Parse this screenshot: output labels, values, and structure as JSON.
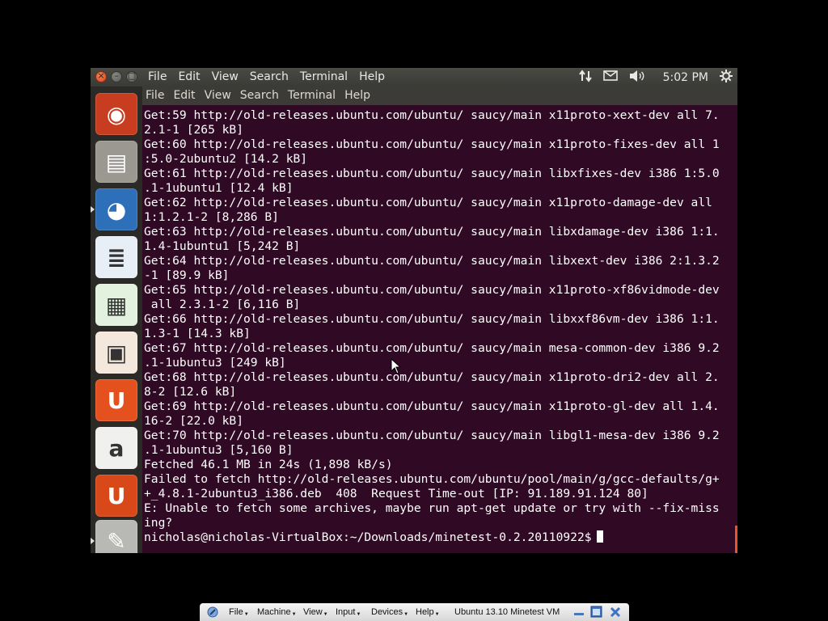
{
  "panel": {
    "menu": [
      "File",
      "Edit",
      "View",
      "Search",
      "Terminal",
      "Help"
    ],
    "clock": "5:02 PM",
    "indicators": {
      "network": "network-updown-icon",
      "mail": "envelope-icon",
      "sound": "speaker-icon",
      "session": "gear-icon"
    }
  },
  "terminal": {
    "menu": [
      "File",
      "Edit",
      "View",
      "Search",
      "Terminal",
      "Help"
    ],
    "lines": [
      "Get:59 http://old-releases.ubuntu.com/ubuntu/ saucy/main x11proto-xext-dev all 7.",
      "2.1-1 [265 kB]",
      "Get:60 http://old-releases.ubuntu.com/ubuntu/ saucy/main x11proto-fixes-dev all 1",
      ":5.0-2ubuntu2 [14.2 kB]",
      "Get:61 http://old-releases.ubuntu.com/ubuntu/ saucy/main libxfixes-dev i386 1:5.0",
      ".1-1ubuntu1 [12.4 kB]",
      "Get:62 http://old-releases.ubuntu.com/ubuntu/ saucy/main x11proto-damage-dev all",
      "1:1.2.1-2 [8,286 B]",
      "Get:63 http://old-releases.ubuntu.com/ubuntu/ saucy/main libxdamage-dev i386 1:1.",
      "1.4-1ubuntu1 [5,242 B]",
      "Get:64 http://old-releases.ubuntu.com/ubuntu/ saucy/main libxext-dev i386 2:1.3.2",
      "-1 [89.9 kB]",
      "Get:65 http://old-releases.ubuntu.com/ubuntu/ saucy/main x11proto-xf86vidmode-dev",
      " all 2.3.1-2 [6,116 B]",
      "Get:66 http://old-releases.ubuntu.com/ubuntu/ saucy/main libxxf86vm-dev i386 1:1.",
      "1.3-1 [14.3 kB]",
      "Get:67 http://old-releases.ubuntu.com/ubuntu/ saucy/main mesa-common-dev i386 9.2",
      ".1-1ubuntu3 [249 kB]",
      "Get:68 http://old-releases.ubuntu.com/ubuntu/ saucy/main x11proto-dri2-dev all 2.",
      "8-2 [12.6 kB]",
      "Get:69 http://old-releases.ubuntu.com/ubuntu/ saucy/main x11proto-gl-dev all 1.4.",
      "16-2 [22.0 kB]",
      "Get:70 http://old-releases.ubuntu.com/ubuntu/ saucy/main libgl1-mesa-dev i386 9.2",
      ".1-1ubuntu3 [5,160 B]",
      "Fetched 46.1 MB in 24s (1,898 kB/s)",
      "Failed to fetch http://old-releases.ubuntu.com/ubuntu/pool/main/g/gcc-defaults/g+",
      "+_4.8.1-2ubuntu3_i386.deb  408  Request Time-out [IP: 91.189.91.124 80]",
      "E: Unable to fetch some archives, maybe run apt-get update or try with --fix-miss",
      "ing?"
    ],
    "prompt": "nicholas@nicholas-VirtualBox:~/Downloads/minetest-0.2.20110922$ "
  },
  "launcher": {
    "items": [
      {
        "name": "ubuntu-dash-icon",
        "glyph": "◉",
        "color": "#c83d1f"
      },
      {
        "name": "files-cabinet-icon",
        "glyph": "▤",
        "color": "#9a9890"
      },
      {
        "name": "firefox-icon",
        "glyph": "◕",
        "color": "#2d6fb8"
      },
      {
        "name": "libreoffice-writer-icon",
        "glyph": "≣",
        "color": "#e8eef6"
      },
      {
        "name": "libreoffice-calc-icon",
        "glyph": "▦",
        "color": "#e3f2df"
      },
      {
        "name": "libreoffice-impress-icon",
        "glyph": "▣",
        "color": "#f4e8dc"
      },
      {
        "name": "ubuntu-software-center-icon",
        "glyph": "U",
        "color": "#e4501e"
      },
      {
        "name": "amazon-icon",
        "glyph": "a",
        "color": "#f0f0ee"
      },
      {
        "name": "ubuntu-one-icon",
        "glyph": "U",
        "color": "#d94819"
      },
      {
        "name": "system-settings-icon",
        "glyph": "✎",
        "color": "#b8b8b4"
      }
    ]
  },
  "vbox": {
    "menu": [
      "File",
      "Machine",
      "View",
      "Input",
      "Devices",
      "Help"
    ],
    "title": "Ubuntu 13.10 Minetest VM"
  }
}
